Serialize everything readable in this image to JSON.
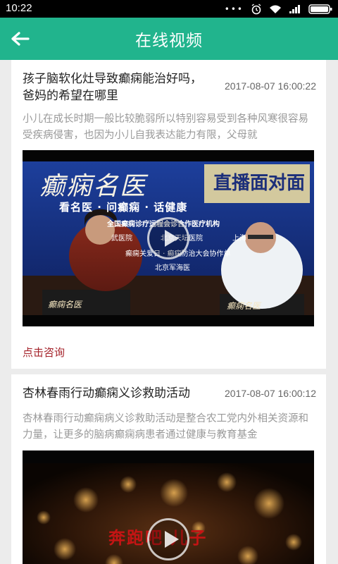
{
  "status_bar": {
    "time": "10:22",
    "dots": "•••"
  },
  "app_bar": {
    "title": "在线视频"
  },
  "videos": [
    {
      "title": "孩子脑软化灶导致癫痫能治好吗，爸妈的希望在哪里",
      "date": "2017-08-07 16:00:22",
      "description": "小儿在成长时期一般比较脆弱所以特别容易受到各种风寒很容易受疾病侵害，也因为小儿自我表达能力有限，父母就",
      "consult_label": "点击咨询",
      "thumbnail": {
        "headline": "癫痫名医",
        "badge": "直播面对面",
        "tagline": "看名医 · 问癫痫 · 话健康",
        "subtitle": "全国癫痫诊疗远程会诊合作医疗机构",
        "hospitals": [
          "武医院",
          "北京天坛医院",
          "上海"
        ],
        "footer": "癫痫关爱日 · 癫痫防治大会协作单",
        "footer2": "北京军海医"
      }
    },
    {
      "title": "杏林春雨行动癫痫义诊救助活动",
      "date": "2017-08-07 16:00:12",
      "description": "杏林春雨行动癫痫病义诊救助活动是整合农工党内外相关资源和力量，让更多的脑病癫痫病患者通过健康与教育基金",
      "thumbnail": {
        "caption": "奔跑吧 儿子"
      }
    }
  ]
}
